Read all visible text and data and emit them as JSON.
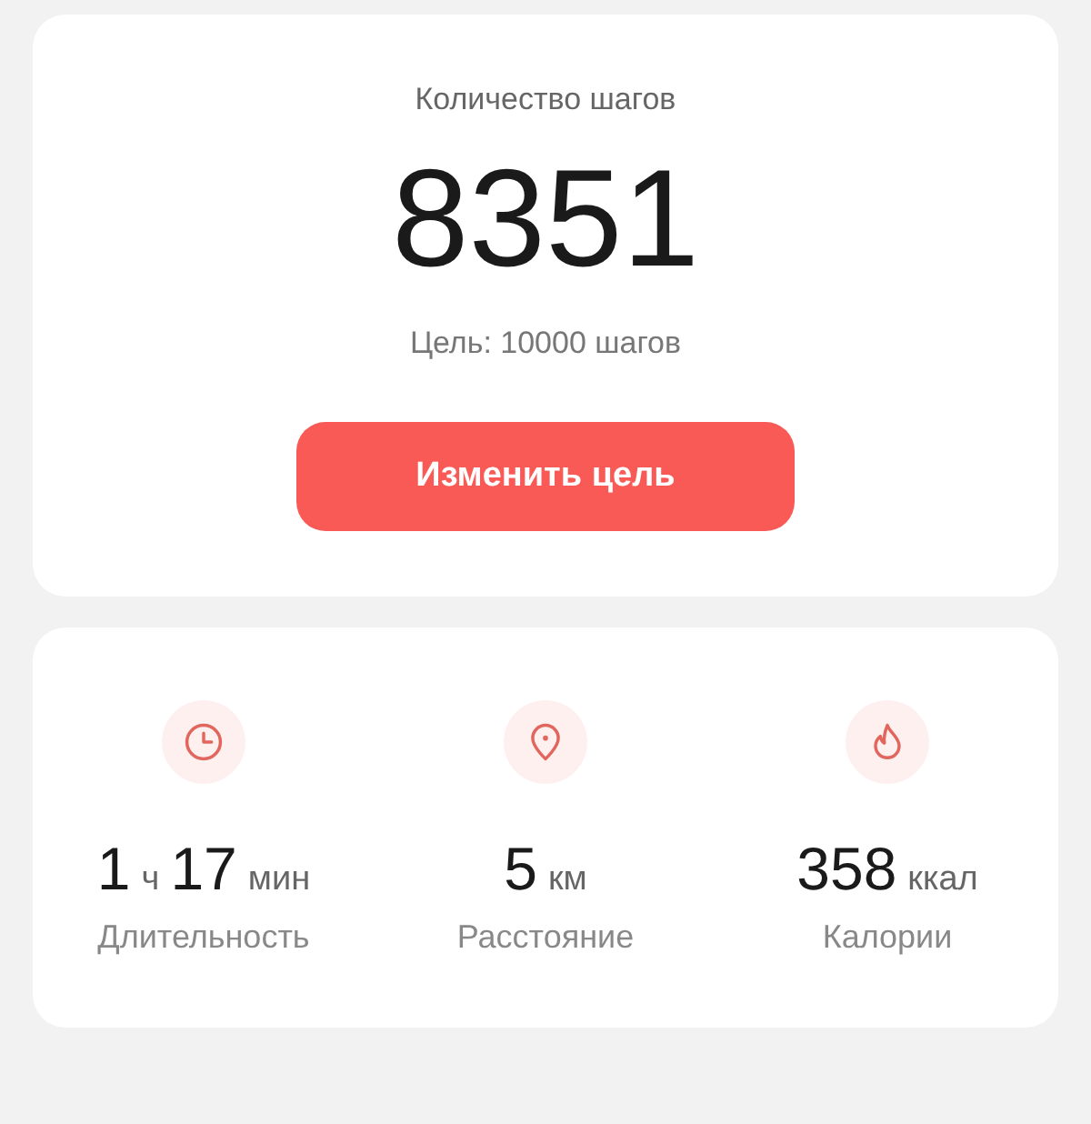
{
  "steps_card": {
    "title": "Количество шагов",
    "steps": "8351",
    "goal": "Цель: 10000 шагов",
    "button": "Изменить цель"
  },
  "stats": [
    {
      "kind": "clock",
      "value": [
        {
          "kind": "number",
          "text": "1"
        },
        {
          "kind": "unit",
          "text": "ч"
        },
        {
          "kind": "number",
          "text": "17"
        },
        {
          "kind": "unit",
          "text": "мин"
        }
      ],
      "label": "Длительность"
    },
    {
      "kind": "pin",
      "value": [
        {
          "kind": "number",
          "text": "5"
        },
        {
          "kind": "unit",
          "text": "км"
        }
      ],
      "label": "Расстояние"
    },
    {
      "kind": "flame",
      "value": [
        {
          "kind": "number",
          "text": "358"
        },
        {
          "kind": "unit",
          "text": "ккал"
        }
      ],
      "label": "Калории"
    }
  ]
}
